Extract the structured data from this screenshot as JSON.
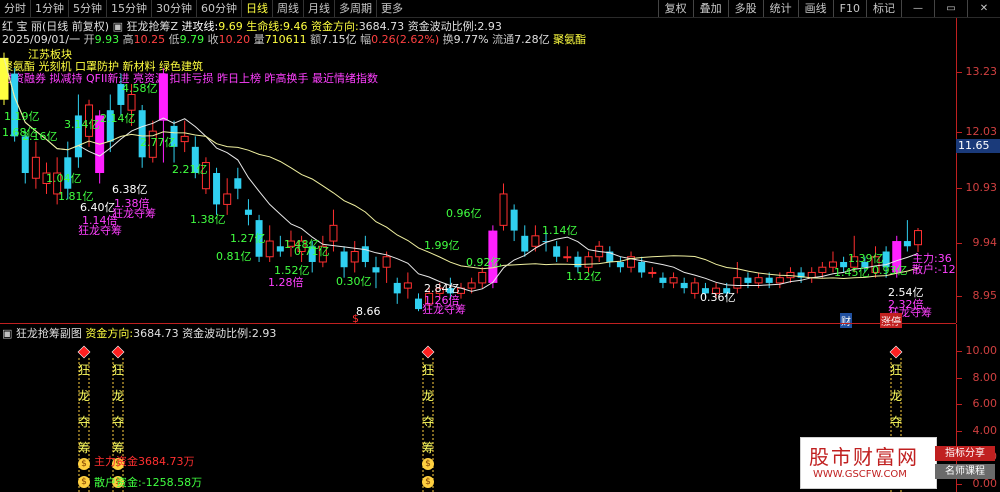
{
  "toolbar": {
    "left": [
      "分时",
      "1分钟",
      "5分钟",
      "15分钟",
      "30分钟",
      "60分钟",
      "日线",
      "周线",
      "月线",
      "多周期",
      "更多"
    ],
    "active": "日线",
    "right": [
      "复权",
      "叠加",
      "多股",
      "统计",
      "画线",
      "F10",
      "标记"
    ],
    "icons": [
      "minus-icon",
      "restore-icon",
      "close-icon"
    ]
  },
  "header": {
    "stock": "红 宝 丽(日线 前复权)",
    "indicator": "狂龙抢筹Z",
    "attack_label": "进攻线:",
    "attack_value": "9.69",
    "life_label": "生命线:",
    "life_value": "9.46",
    "fund_label": "资金方向:",
    "fund_value": "3684.73",
    "vol_label": "资金波动比例:",
    "vol_value": "2.93"
  },
  "quote": {
    "date": "2025/09/01/一",
    "open_label": "开",
    "open": "9.93",
    "high_label": "高",
    "high": "10.25",
    "low_label": "低",
    "low": "9.79",
    "close_label": "收",
    "close": "10.20",
    "vol_label": "量",
    "vol": "710611",
    "amount_label": "额",
    "amount": "7.15亿",
    "chg_label": "幅",
    "chg": "0.26(2.62%)",
    "turnover_label": "换",
    "turnover": "9.77%",
    "float_label": "流通",
    "float": "7.28亿",
    "tag": "聚氨酯"
  },
  "concepts": {
    "line1": "江苏板块",
    "line2": "聚氨酯 光刻机 口罩防护 新材料 绿色建筑",
    "line3": "融资融券 拟减持 QFII新进 亮资源 扣非亏损 昨日上榜 昨高换手 最近情绪指数"
  },
  "yaxis": {
    "labels": [
      "13.23",
      "12.03",
      "10.93",
      "9.94",
      "8.95"
    ],
    "current_price": "11.65",
    "sub_labels": [
      "10.00",
      "8.00",
      "6.00",
      "4.00",
      "2.00",
      "0.00"
    ]
  },
  "chart_labels": [
    {
      "text": "1.19亿",
      "color": "#40ff40"
    },
    {
      "text": "1.68亿",
      "color": "#40ff40"
    },
    {
      "text": "2.16亿",
      "color": "#40ff40"
    },
    {
      "text": "1.04亿",
      "color": "#40ff40"
    },
    {
      "text": "1.81亿",
      "color": "#40ff40"
    },
    {
      "text": "3.14亿",
      "color": "#40ff40"
    },
    {
      "text": "2.14亿",
      "color": "#40ff40"
    },
    {
      "text": "4.58亿",
      "color": "#40ff40"
    },
    {
      "text": "2.77亿",
      "color": "#40ff40"
    },
    {
      "text": "6.38亿",
      "color": "#ffffff"
    },
    {
      "text": "1.38倍",
      "color": "#ff40ff"
    },
    {
      "text": "6.40亿",
      "color": "#ffffff"
    },
    {
      "text": "1.14倍",
      "color": "#ff40ff"
    },
    {
      "text": "狂龙夺筹",
      "color": "#ff40ff"
    },
    {
      "text": "狂龙夺筹",
      "color": "#ff40ff"
    },
    {
      "text": "2.21亿",
      "color": "#40ff40"
    },
    {
      "text": "1.38亿",
      "color": "#40ff40"
    },
    {
      "text": "1.27亿",
      "color": "#40ff40"
    },
    {
      "text": "0.81亿",
      "color": "#40ff40"
    },
    {
      "text": "1.48亿",
      "color": "#40ff40"
    },
    {
      "text": "0.71亿",
      "color": "#40ff40"
    },
    {
      "text": "1.52亿",
      "color": "#40ff40"
    },
    {
      "text": "1.28倍",
      "color": "#ff40ff"
    },
    {
      "text": "0.30亿",
      "color": "#40ff40"
    },
    {
      "text": "8.66",
      "color": "#ffffff"
    },
    {
      "text": "0.96亿",
      "color": "#40ff40"
    },
    {
      "text": "1.99亿",
      "color": "#40ff40"
    },
    {
      "text": "0.92亿",
      "color": "#40ff40"
    },
    {
      "text": "2.84亿",
      "color": "#ffffff"
    },
    {
      "text": "1.26倍",
      "color": "#ff40ff"
    },
    {
      "text": "狂龙夺筹",
      "color": "#ff40ff"
    },
    {
      "text": "1.14亿",
      "color": "#40ff40"
    },
    {
      "text": "1.12亿",
      "color": "#40ff40"
    },
    {
      "text": "0.36亿",
      "color": "#ffffff"
    },
    {
      "text": "1.39亿",
      "color": "#40ff40"
    },
    {
      "text": "1.45亿",
      "color": "#40ff40"
    },
    {
      "text": "0.93亿",
      "color": "#40ff40"
    },
    {
      "text": "2.54亿",
      "color": "#ffffff"
    },
    {
      "text": "2.32倍",
      "color": "#ff40ff"
    },
    {
      "text": "狂龙夺筹",
      "color": "#ff40ff"
    },
    {
      "text": "主力:36",
      "color": "#ff40ff"
    },
    {
      "text": "散户:-12",
      "color": "#ff40ff"
    }
  ],
  "bottom_marks": {
    "fin": "财",
    "limit": "涨停",
    "dollar": "$"
  },
  "subchart": {
    "title": "狂龙抢筹副图",
    "fund_label": "资金方向:",
    "fund_value": "3684.73",
    "vol_label": "资金波动比例:",
    "vol_value": "2.93",
    "main_fund": "主力资金3684.73万",
    "retail_fund": "散户资金:-1258.58万",
    "signal_chars": [
      "狂",
      "龙",
      "夺",
      "筹"
    ]
  },
  "watermark": {
    "title": "股市财富网",
    "url": "WWW.GSCFW.COM",
    "tag1": "指标分享",
    "tag2": "名师课程"
  },
  "colors": {
    "up": "#ff3030",
    "down": "#30d0f0",
    "magenta": "#ff20ff",
    "ma_yellow": "#f0f0a0",
    "ma_white": "#e8e8e8",
    "green_text": "#40ff40"
  },
  "chart_data": {
    "type": "candlestick",
    "price_ticks": [
      13.23,
      12.03,
      10.93,
      9.94,
      8.95
    ],
    "candles": [
      {
        "o": 12.7,
        "c": 13.5,
        "h": 13.6,
        "l": 12.6,
        "kind": "yellow"
      },
      {
        "o": 13.2,
        "c": 12.0,
        "h": 13.3,
        "l": 11.9,
        "kind": "down"
      },
      {
        "o": 12.0,
        "c": 11.3,
        "h": 12.1,
        "l": 11.1,
        "kind": "down"
      },
      {
        "o": 11.2,
        "c": 11.6,
        "h": 11.9,
        "l": 11.0,
        "kind": "up"
      },
      {
        "o": 11.1,
        "c": 11.3,
        "h": 11.5,
        "l": 10.9,
        "kind": "up"
      },
      {
        "o": 11.3,
        "c": 10.9,
        "h": 11.6,
        "l": 10.7,
        "kind": "up"
      },
      {
        "o": 11.0,
        "c": 11.6,
        "h": 11.9,
        "l": 10.8,
        "kind": "down"
      },
      {
        "o": 11.6,
        "c": 12.4,
        "h": 12.8,
        "l": 11.4,
        "kind": "down"
      },
      {
        "o": 12.0,
        "c": 12.6,
        "h": 12.7,
        "l": 11.8,
        "kind": "up"
      },
      {
        "o": 12.4,
        "c": 11.3,
        "h": 12.5,
        "l": 11.1,
        "kind": "magenta"
      },
      {
        "o": 11.9,
        "c": 12.5,
        "h": 12.8,
        "l": 11.7,
        "kind": "down"
      },
      {
        "o": 12.6,
        "c": 13.0,
        "h": 13.2,
        "l": 12.4,
        "kind": "down"
      },
      {
        "o": 12.8,
        "c": 12.5,
        "h": 13.0,
        "l": 12.2,
        "kind": "up"
      },
      {
        "o": 12.5,
        "c": 11.6,
        "h": 12.6,
        "l": 11.4,
        "kind": "down"
      },
      {
        "o": 11.6,
        "c": 12.1,
        "h": 12.3,
        "l": 11.5,
        "kind": "up"
      },
      {
        "o": 12.3,
        "c": 13.2,
        "h": 13.3,
        "l": 11.5,
        "kind": "magenta"
      },
      {
        "o": 12.2,
        "c": 11.8,
        "h": 12.3,
        "l": 11.5,
        "kind": "down"
      },
      {
        "o": 11.9,
        "c": 12.0,
        "h": 12.3,
        "l": 11.7,
        "kind": "up"
      },
      {
        "o": 11.8,
        "c": 11.3,
        "h": 12.0,
        "l": 11.2,
        "kind": "down"
      },
      {
        "o": 11.0,
        "c": 11.5,
        "h": 11.6,
        "l": 10.9,
        "kind": "up"
      },
      {
        "o": 11.3,
        "c": 10.7,
        "h": 11.4,
        "l": 10.5,
        "kind": "down"
      },
      {
        "o": 10.7,
        "c": 10.9,
        "h": 11.2,
        "l": 10.5,
        "kind": "up"
      },
      {
        "o": 11.2,
        "c": 11.0,
        "h": 11.4,
        "l": 10.8,
        "kind": "down"
      },
      {
        "o": 10.6,
        "c": 10.5,
        "h": 10.8,
        "l": 10.3,
        "kind": "down"
      },
      {
        "o": 10.4,
        "c": 9.7,
        "h": 10.5,
        "l": 9.6,
        "kind": "down"
      },
      {
        "o": 9.7,
        "c": 10.0,
        "h": 10.3,
        "l": 9.6,
        "kind": "up"
      },
      {
        "o": 9.9,
        "c": 9.8,
        "h": 10.1,
        "l": 9.7,
        "kind": "down"
      },
      {
        "o": 9.9,
        "c": 10.0,
        "h": 10.2,
        "l": 9.7,
        "kind": "up"
      },
      {
        "o": 9.8,
        "c": 10.0,
        "h": 10.1,
        "l": 9.6,
        "kind": "up"
      },
      {
        "o": 9.9,
        "c": 9.6,
        "h": 10.0,
        "l": 9.4,
        "kind": "down"
      },
      {
        "o": 9.6,
        "c": 9.9,
        "h": 10.1,
        "l": 9.5,
        "kind": "up"
      },
      {
        "o": 10.0,
        "c": 10.3,
        "h": 10.6,
        "l": 9.8,
        "kind": "up"
      },
      {
        "o": 9.8,
        "c": 9.5,
        "h": 9.9,
        "l": 9.3,
        "kind": "down"
      },
      {
        "o": 9.6,
        "c": 9.8,
        "h": 10.0,
        "l": 9.4,
        "kind": "up"
      },
      {
        "o": 9.9,
        "c": 9.6,
        "h": 10.1,
        "l": 9.5,
        "kind": "down"
      },
      {
        "o": 9.4,
        "c": 9.5,
        "h": 9.7,
        "l": 9.1,
        "kind": "down"
      },
      {
        "o": 9.5,
        "c": 9.7,
        "h": 9.8,
        "l": 9.2,
        "kind": "up"
      },
      {
        "o": 9.2,
        "c": 9.0,
        "h": 9.3,
        "l": 8.8,
        "kind": "down"
      },
      {
        "o": 9.1,
        "c": 9.2,
        "h": 9.4,
        "l": 8.9,
        "kind": "up"
      },
      {
        "o": 8.9,
        "c": 8.7,
        "h": 9.0,
        "l": 8.66,
        "kind": "down"
      },
      {
        "o": 8.8,
        "c": 9.0,
        "h": 9.1,
        "l": 8.7,
        "kind": "up"
      },
      {
        "o": 9.0,
        "c": 9.1,
        "h": 9.2,
        "l": 8.9,
        "kind": "up"
      },
      {
        "o": 9.1,
        "c": 9.0,
        "h": 9.3,
        "l": 8.9,
        "kind": "down"
      },
      {
        "o": 9.0,
        "c": 9.1,
        "h": 9.2,
        "l": 8.9,
        "kind": "up"
      },
      {
        "o": 9.1,
        "c": 9.2,
        "h": 9.3,
        "l": 9.0,
        "kind": "up"
      },
      {
        "o": 9.2,
        "c": 9.4,
        "h": 9.5,
        "l": 9.1,
        "kind": "up"
      },
      {
        "o": 9.2,
        "c": 10.2,
        "h": 10.3,
        "l": 9.1,
        "kind": "magenta"
      },
      {
        "o": 10.3,
        "c": 10.9,
        "h": 11.1,
        "l": 10.2,
        "kind": "up"
      },
      {
        "o": 10.6,
        "c": 10.2,
        "h": 10.7,
        "l": 10.0,
        "kind": "down"
      },
      {
        "o": 10.1,
        "c": 9.8,
        "h": 10.3,
        "l": 9.7,
        "kind": "down"
      },
      {
        "o": 9.9,
        "c": 10.1,
        "h": 10.3,
        "l": 9.8,
        "kind": "up"
      },
      {
        "o": 10.0,
        "c": 10.0,
        "h": 10.2,
        "l": 9.8,
        "kind": "down"
      },
      {
        "o": 9.9,
        "c": 9.7,
        "h": 10.0,
        "l": 9.6,
        "kind": "down"
      },
      {
        "o": 9.7,
        "c": 9.7,
        "h": 9.9,
        "l": 9.6,
        "kind": "up"
      },
      {
        "o": 9.7,
        "c": 9.5,
        "h": 9.8,
        "l": 9.4,
        "kind": "down"
      },
      {
        "o": 9.5,
        "c": 9.7,
        "h": 9.8,
        "l": 9.4,
        "kind": "up"
      },
      {
        "o": 9.7,
        "c": 9.9,
        "h": 10.0,
        "l": 9.6,
        "kind": "up"
      },
      {
        "o": 9.8,
        "c": 9.6,
        "h": 9.9,
        "l": 9.5,
        "kind": "down"
      },
      {
        "o": 9.6,
        "c": 9.5,
        "h": 9.7,
        "l": 9.4,
        "kind": "down"
      },
      {
        "o": 9.5,
        "c": 9.7,
        "h": 9.8,
        "l": 9.4,
        "kind": "up"
      },
      {
        "o": 9.6,
        "c": 9.4,
        "h": 9.7,
        "l": 9.3,
        "kind": "down"
      },
      {
        "o": 9.4,
        "c": 9.4,
        "h": 9.5,
        "l": 9.3,
        "kind": "up"
      },
      {
        "o": 9.3,
        "c": 9.2,
        "h": 9.4,
        "l": 9.1,
        "kind": "down"
      },
      {
        "o": 9.2,
        "c": 9.3,
        "h": 9.4,
        "l": 9.1,
        "kind": "up"
      },
      {
        "o": 9.2,
        "c": 9.1,
        "h": 9.3,
        "l": 9.0,
        "kind": "down"
      },
      {
        "o": 9.0,
        "c": 9.2,
        "h": 9.3,
        "l": 8.9,
        "kind": "up"
      },
      {
        "o": 9.1,
        "c": 9.0,
        "h": 9.2,
        "l": 8.9,
        "kind": "down"
      },
      {
        "o": 9.0,
        "c": 9.1,
        "h": 9.2,
        "l": 8.9,
        "kind": "up"
      },
      {
        "o": 9.1,
        "c": 9.0,
        "h": 9.2,
        "l": 8.9,
        "kind": "down"
      },
      {
        "o": 9.1,
        "c": 9.3,
        "h": 9.6,
        "l": 9.0,
        "kind": "up"
      },
      {
        "o": 9.3,
        "c": 9.2,
        "h": 9.4,
        "l": 9.1,
        "kind": "down"
      },
      {
        "o": 9.2,
        "c": 9.3,
        "h": 9.4,
        "l": 9.1,
        "kind": "up"
      },
      {
        "o": 9.3,
        "c": 9.2,
        "h": 9.4,
        "l": 9.1,
        "kind": "down"
      },
      {
        "o": 9.2,
        "c": 9.3,
        "h": 9.4,
        "l": 9.1,
        "kind": "up"
      },
      {
        "o": 9.3,
        "c": 9.4,
        "h": 9.5,
        "l": 9.2,
        "kind": "up"
      },
      {
        "o": 9.4,
        "c": 9.3,
        "h": 9.5,
        "l": 9.2,
        "kind": "down"
      },
      {
        "o": 9.3,
        "c": 9.4,
        "h": 9.5,
        "l": 9.2,
        "kind": "up"
      },
      {
        "o": 9.4,
        "c": 9.5,
        "h": 9.6,
        "l": 9.3,
        "kind": "up"
      },
      {
        "o": 9.5,
        "c": 9.6,
        "h": 9.8,
        "l": 9.4,
        "kind": "up"
      },
      {
        "o": 9.6,
        "c": 9.5,
        "h": 9.7,
        "l": 9.4,
        "kind": "down"
      },
      {
        "o": 9.5,
        "c": 9.7,
        "h": 10.1,
        "l": 9.4,
        "kind": "up"
      },
      {
        "o": 9.6,
        "c": 9.5,
        "h": 9.7,
        "l": 9.4,
        "kind": "down"
      },
      {
        "o": 9.4,
        "c": 9.7,
        "h": 9.9,
        "l": 9.3,
        "kind": "up"
      },
      {
        "o": 9.8,
        "c": 9.5,
        "h": 9.9,
        "l": 9.3,
        "kind": "down"
      },
      {
        "o": 9.4,
        "c": 10.0,
        "h": 10.1,
        "l": 9.3,
        "kind": "magenta"
      },
      {
        "o": 9.9,
        "c": 10.0,
        "h": 10.4,
        "l": 9.8,
        "kind": "down"
      },
      {
        "o": 9.93,
        "c": 10.2,
        "h": 10.25,
        "l": 9.79,
        "kind": "up"
      }
    ],
    "signals": [
      9,
      15,
      46,
      85
    ]
  }
}
